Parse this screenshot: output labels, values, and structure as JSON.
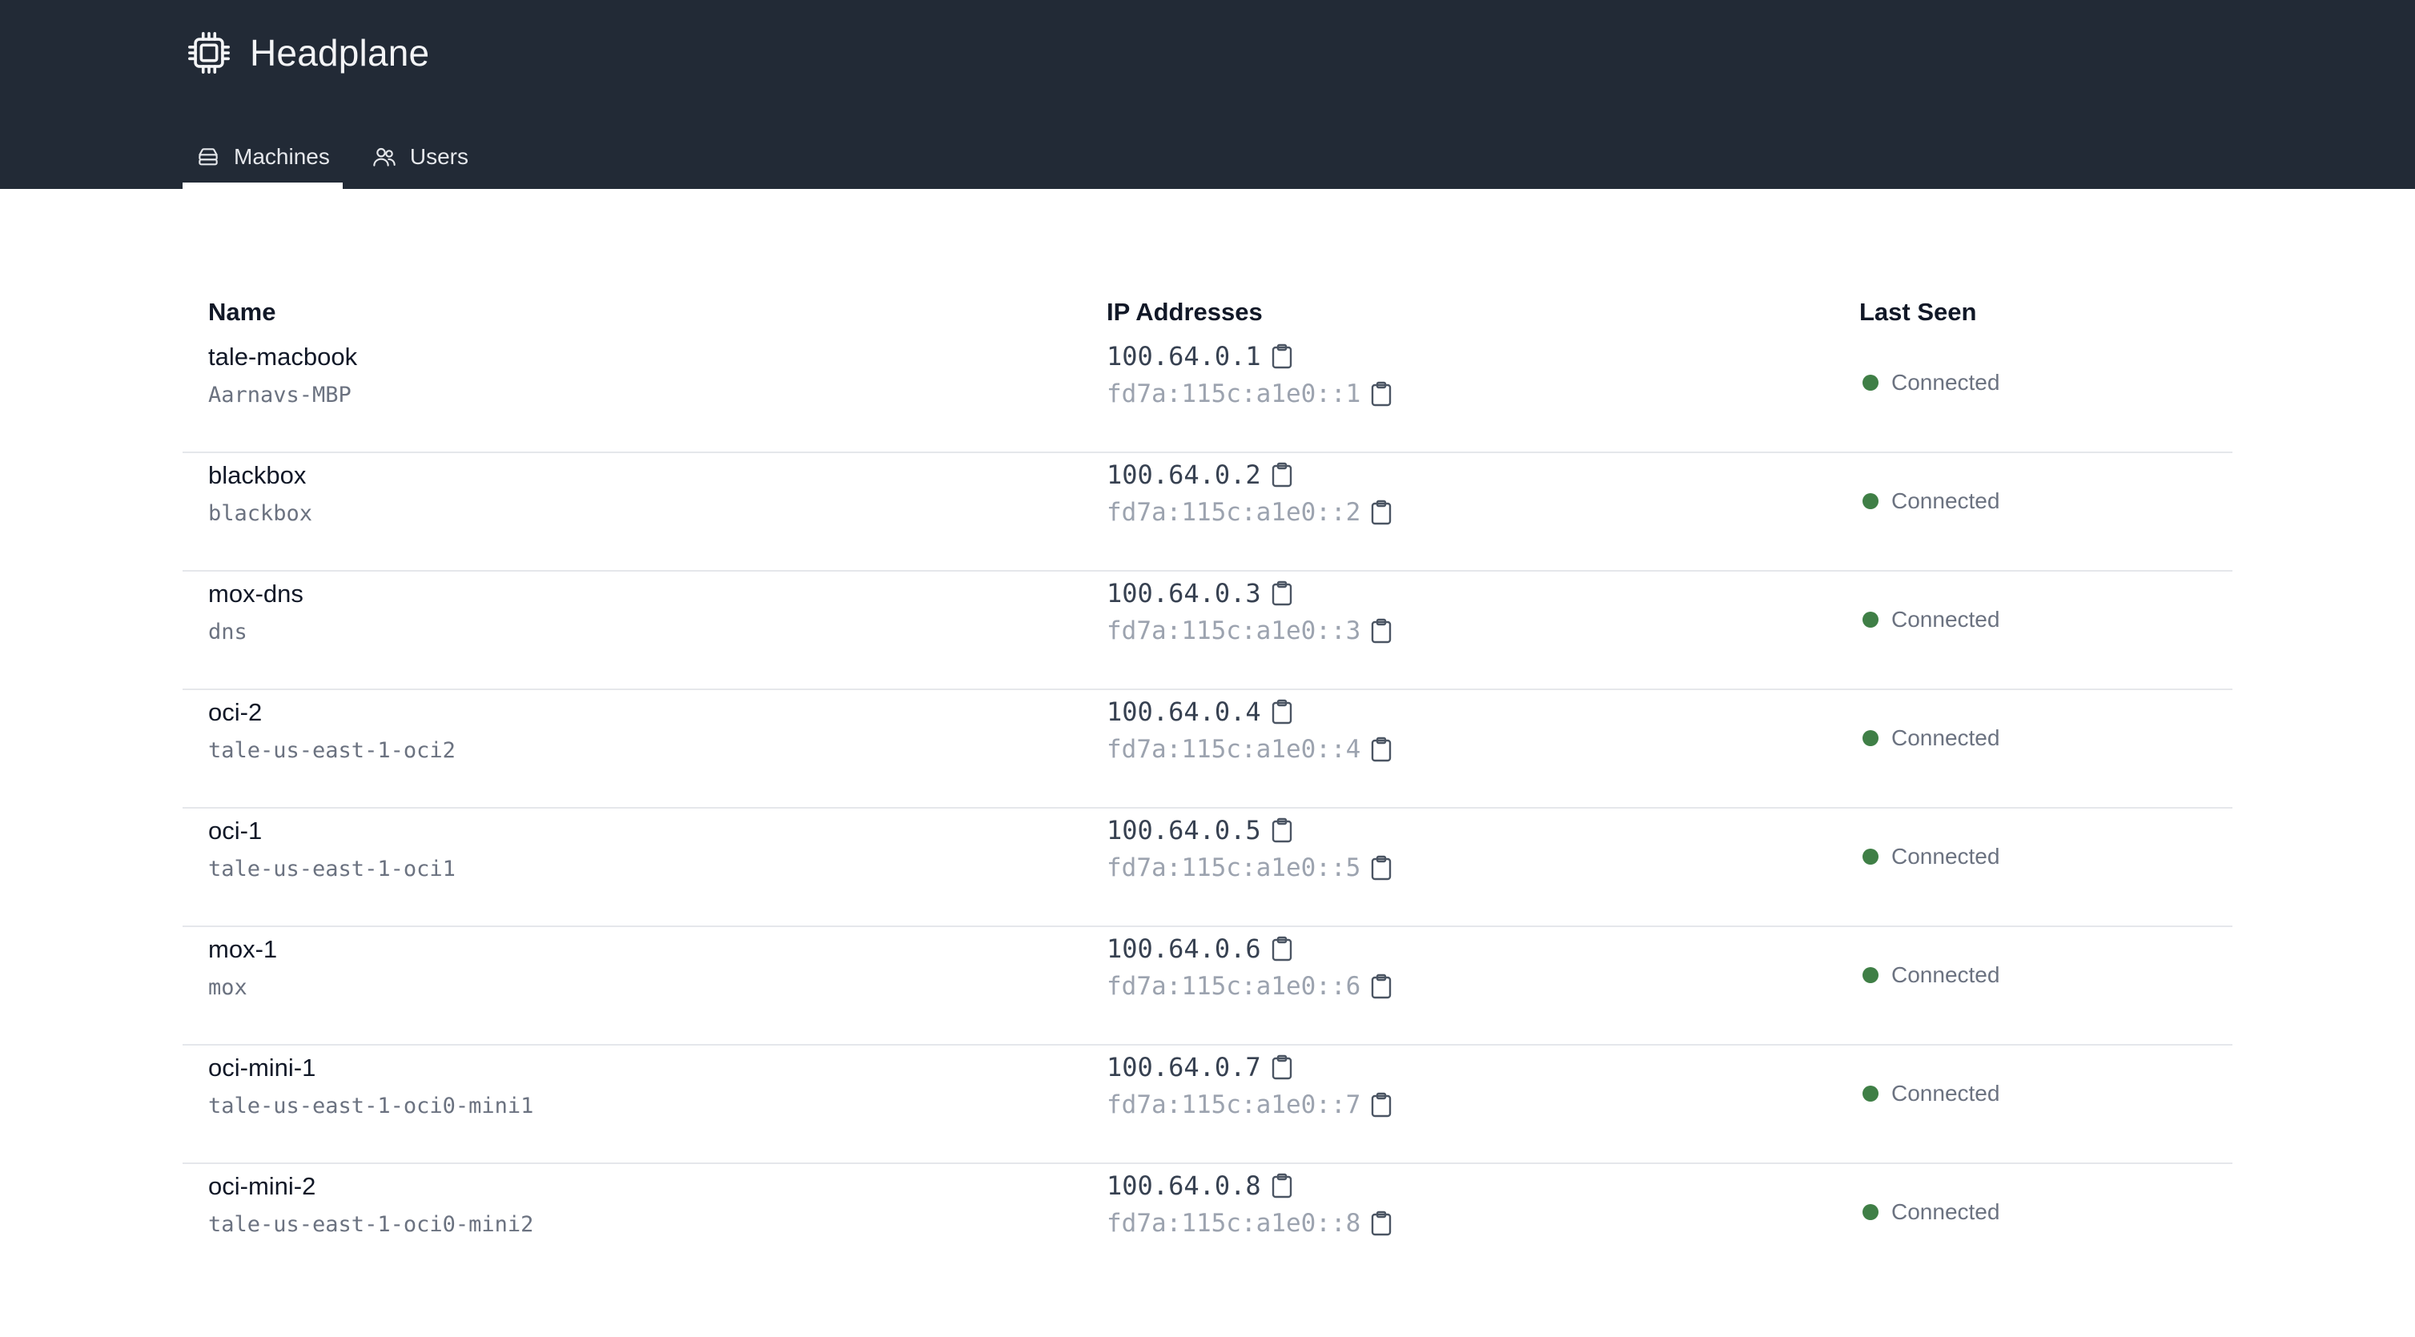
{
  "app": {
    "title": "Headplane"
  },
  "tabs": [
    {
      "label": "Machines",
      "icon": "server-icon",
      "active": true
    },
    {
      "label": "Users",
      "icon": "users-icon",
      "active": false
    }
  ],
  "table": {
    "headers": {
      "name": "Name",
      "ip": "IP Addresses",
      "last_seen": "Last Seen"
    },
    "rows": [
      {
        "name": "tale-macbook",
        "host": "Aarnavs-MBP",
        "ipv4": "100.64.0.1",
        "ipv6": "fd7a:115c:a1e0::1",
        "status": "Connected"
      },
      {
        "name": "blackbox",
        "host": "blackbox",
        "ipv4": "100.64.0.2",
        "ipv6": "fd7a:115c:a1e0::2",
        "status": "Connected"
      },
      {
        "name": "mox-dns",
        "host": "dns",
        "ipv4": "100.64.0.3",
        "ipv6": "fd7a:115c:a1e0::3",
        "status": "Connected"
      },
      {
        "name": "oci-2",
        "host": "tale-us-east-1-oci2",
        "ipv4": "100.64.0.4",
        "ipv6": "fd7a:115c:a1e0::4",
        "status": "Connected"
      },
      {
        "name": "oci-1",
        "host": "tale-us-east-1-oci1",
        "ipv4": "100.64.0.5",
        "ipv6": "fd7a:115c:a1e0::5",
        "status": "Connected"
      },
      {
        "name": "mox-1",
        "host": "mox",
        "ipv4": "100.64.0.6",
        "ipv6": "fd7a:115c:a1e0::6",
        "status": "Connected"
      },
      {
        "name": "oci-mini-1",
        "host": "tale-us-east-1-oci0-mini1",
        "ipv4": "100.64.0.7",
        "ipv6": "fd7a:115c:a1e0::7",
        "status": "Connected"
      },
      {
        "name": "oci-mini-2",
        "host": "tale-us-east-1-oci0-mini2",
        "ipv4": "100.64.0.8",
        "ipv6": "fd7a:115c:a1e0::8",
        "status": "Connected"
      }
    ]
  },
  "colors": {
    "header_bg": "#222a36",
    "status_connected": "#3f7f46"
  }
}
